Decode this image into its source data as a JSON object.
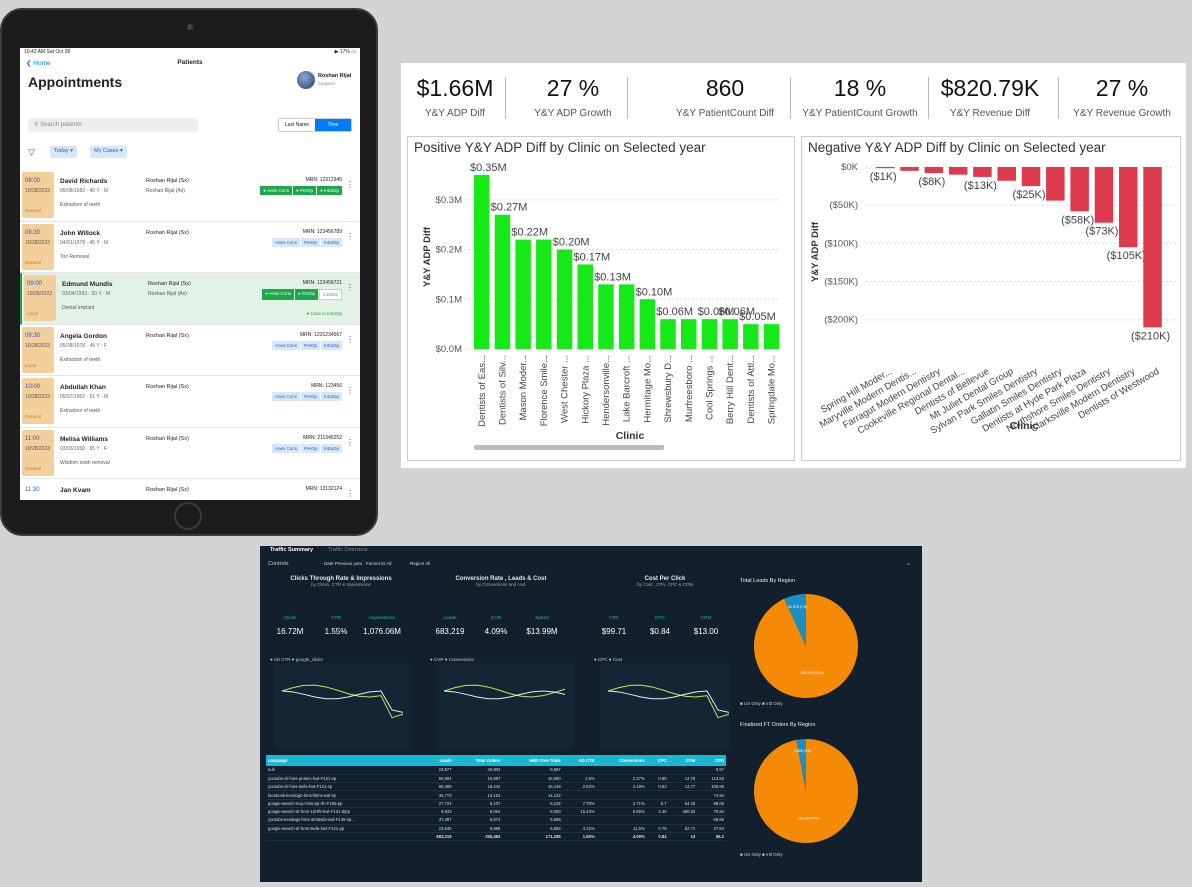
{
  "ipad": {
    "status_time": "10:42 AM  Sat Oct 28",
    "status_battery": "17%",
    "back_label": "Home",
    "nav_title": "Patients",
    "page_title": "Appointments",
    "user_name": "Roshan Rijal",
    "user_role": "Surgeon",
    "search_placeholder": "Search patients",
    "sort_options": [
      "Last Name",
      "Time"
    ],
    "filter_today": "Today ▾",
    "filter_cases": "My Cases ▾",
    "appointments": [
      {
        "time": "08:00",
        "date": "10/28/2023",
        "tag": "General",
        "name": "David Richards",
        "dob": "05/08/1983 · 40 Y · M",
        "proc": "Extraction of teeth",
        "doc": "Roshan Rijal (Sx)",
        "doc2": "Roshan Rijal (Ax)",
        "mrn": "MRN: 12312345",
        "pills": [
          "Anes Cons",
          "PreOp",
          "IntraOp"
        ],
        "state": "green3",
        "status": ""
      },
      {
        "time": "08:30",
        "date": "10/28/2023",
        "tag": "General",
        "name": "John Willock",
        "dob": "04/01/1978 · 45 Y · M",
        "proc": "Tori Removal",
        "doc": "Roshan Rijal (Sx)",
        "doc2": "",
        "mrn": "MRN: 123456789",
        "pills": [
          "Anes Cons",
          "PreOp",
          "IntraOp"
        ],
        "state": "blue",
        "status": ""
      },
      {
        "time": "09:00",
        "date": "10/28/2023",
        "tag": "Local",
        "name": "Edmund Mundis",
        "dob": "03/04/1993 · 30 Y · M",
        "proc": "Dental Implant",
        "doc": "Roshan Rijal (Sx)",
        "doc2": "Roshan Rijal (Ax)",
        "mrn": "MRN: 123456721",
        "pills": [
          "Anes Cons",
          "PreOp",
          "IntraOp"
        ],
        "state": "green2",
        "status": "● Case in IntraOp"
      },
      {
        "time": "09:30",
        "date": "10/28/2023",
        "tag": "Local",
        "name": "Angela Gordon",
        "dob": "05/28/1978 · 45 Y · F",
        "proc": "Extraction of teeth",
        "doc": "Roshan Rijal (Sx)",
        "doc2": "",
        "mrn": "MRN: 1231234567",
        "pills": [
          "Anes Cons",
          "PreOp",
          "IntraOp"
        ],
        "state": "blue",
        "status": ""
      },
      {
        "time": "10:00",
        "date": "10/28/2023",
        "tag": "General",
        "name": "Abdullah Khan",
        "dob": "05/07/1962 · 61 Y · M",
        "proc": "Extraction of teeth",
        "doc": "Roshan Rijal (Sx)",
        "doc2": "",
        "mrn": "MRN: 123456",
        "pills": [
          "Anes Cons",
          "PreOp",
          "IntraOp"
        ],
        "state": "blue",
        "status": ""
      },
      {
        "time": "11:00",
        "date": "10/28/2023",
        "tag": "General",
        "name": "Melisa Williams",
        "dob": "03/03/1958 · 65 Y · F",
        "proc": "Wisdom tooth removal",
        "doc": "Roshan Rijal (Sx)",
        "doc2": "",
        "mrn": "MRN: 211345252",
        "pills": [
          "Anes Cons",
          "PreOp",
          "IntraOp"
        ],
        "state": "blue",
        "status": ""
      },
      {
        "time": "11:30",
        "date": "",
        "tag": "",
        "name": "Jan Kvam",
        "dob": "",
        "proc": "",
        "doc": "Roshan Rijal (Sx)",
        "doc2": "",
        "mrn": "MRN: 12132124",
        "pills": [],
        "state": "none",
        "status": ""
      }
    ]
  },
  "pbi": {
    "kpis": [
      {
        "value": "$1.66M",
        "label": "Y&Y ADP Diff"
      },
      {
        "value": "27 %",
        "label": "Y&Y ADP Growth"
      },
      {
        "value": "860",
        "label": "Y&Y PatientCount Diff"
      },
      {
        "value": "18 %",
        "label": "Y&Y PatientCount Growth"
      },
      {
        "value": "$820.79K",
        "label": "Y&Y Revenue Diff"
      },
      {
        "value": "27 %",
        "label": "Y&Y Revenue Growth"
      }
    ],
    "colors": {
      "positive": "#17e817",
      "negative": "#dd3a4d"
    }
  },
  "chart_data": [
    {
      "type": "bar",
      "title": "Positive Y&Y ADP Diff by Clinic on Selected year",
      "xlabel": "Clinic",
      "ylabel": "Y&Y ADP Diff",
      "ylim": [
        0,
        0.37
      ],
      "yticks": [
        "$0.0M",
        "$0.1M",
        "$0.2M",
        "$0.3M"
      ],
      "categories": [
        "Dentists of Eas...",
        "Dentists of Silv...",
        "Mason Moder...",
        "Florence Smile...",
        "West Chester ...",
        "Hickory Plaza ...",
        "Hendersonville...",
        "Lake Barcroft ...",
        "Hermitage Mo...",
        "Shrewsbury D...",
        "Murfreesboro ...",
        "Cool Springs ...",
        "Berry Hill Dent...",
        "Dentists of Attl...",
        "Springdale Mo..."
      ],
      "values": [
        0.35,
        0.27,
        0.22,
        0.22,
        0.2,
        0.17,
        0.13,
        0.13,
        0.1,
        0.06,
        0.06,
        0.06,
        0.06,
        0.05,
        0.05
      ],
      "data_labels": [
        "$0.35M",
        "$0.27M",
        "$0.22M",
        "",
        "$0.20M",
        "$0.17M",
        "$0.13M",
        "",
        "$0.10M",
        "$0.06M",
        "",
        "$0.06M",
        "$0.06M",
        "$0.05M",
        ""
      ]
    },
    {
      "type": "bar",
      "title": "Negative Y&Y ADP Diff by Clinic on Selected year",
      "xlabel": "Clinic",
      "ylabel": "Y&Y ADP Diff",
      "ylim": [
        -220,
        0
      ],
      "yticks": [
        "$0K",
        "($50K)",
        "($100K)",
        "($150K)",
        "($200K)"
      ],
      "categories": [
        "Spring Hill Moder...",
        "Maryville Modern Dentis...",
        "Farragut Modern Dentistry",
        "Cookeville Regional Dental...",
        "Dentists of Bellevue",
        "Mt Juliet Dental Group",
        "Sylvan Park Smiles Dentistry",
        "Gallatin Smiles Dentistry",
        "Dentists at Hyde Park Plaza",
        "Northshore Smiles Dentistry",
        "Clarksville Modern Dentistry",
        "Dentists of Westwood"
      ],
      "values": [
        -1,
        -5,
        -8,
        -10,
        -13,
        -18,
        -25,
        -44,
        -58,
        -73,
        -105,
        -210
      ],
      "data_labels": [
        "($1K)",
        "",
        "($8K)",
        "",
        "($13K)",
        "",
        "($25K)",
        "",
        "($58K)",
        "($73K)",
        "($105K)",
        "($210K)"
      ]
    },
    {
      "type": "line",
      "title": "Clicks Through Rate & Impressions",
      "series": [
        {
          "name": "AD CTR"
        },
        {
          "name": "google_clicks"
        }
      ]
    },
    {
      "type": "line",
      "title": "Conversion Rate , Leads & Cost",
      "series": [
        {
          "name": "CVR"
        },
        {
          "name": "Conversions"
        }
      ]
    },
    {
      "type": "line",
      "title": "Cost Per Click",
      "series": [
        {
          "name": "CPC"
        },
        {
          "name": "Cost"
        }
      ]
    },
    {
      "type": "pie",
      "title": "Total Leads By Region",
      "categories": [
        "US Only",
        "Intl Only"
      ],
      "values": [
        93.1,
        6.9
      ],
      "data_labels": [
        "635,190 (93%)",
        "41,076 (7%)"
      ]
    },
    {
      "type": "pie",
      "title": "Finalized FT Orders By Region",
      "categories": [
        "US Only",
        "Intl Only"
      ],
      "values": [
        97,
        3
      ],
      "data_labels": [
        "204,38 (97%)",
        "4,888 (3%)"
      ]
    }
  ],
  "traffic": {
    "tabs": [
      "Traffic Summary",
      "Traffic Overview"
    ],
    "controls": "Controls",
    "filters": [
      "Date Previous year",
      "Funnel ID All",
      "Region All"
    ],
    "sections": [
      {
        "title": "Clicks Through Rate & Impressions",
        "sub": "by Clicks, CTR & Impressions",
        "kpis": [
          {
            "l": "Clicks",
            "v": "16.72M"
          },
          {
            "l": "CTR",
            "v": "1.55%"
          },
          {
            "l": "Impressions",
            "v": "1,076.06M"
          }
        ],
        "legend": "● AD CTR  ● google_clicks"
      },
      {
        "title": "Conversion Rate , Leads & Cost",
        "sub": "by Conversions and cost",
        "kpis": [
          {
            "l": "Leads",
            "v": "683,219"
          },
          {
            "l": "CVR",
            "v": "4.09%"
          },
          {
            "l": "Spend",
            "v": "$13.99M"
          }
        ],
        "legend": "● CVR  ● Conversions"
      },
      {
        "title": "Cost Per Click",
        "sub": "by Cost , CPA, CPC & CPM",
        "kpis": [
          {
            "l": "CPA",
            "v": "$99.71"
          },
          {
            "l": "CPC",
            "v": "$0.84"
          },
          {
            "l": "CPM",
            "v": "$13.00"
          }
        ],
        "legend": "● CPC  ● Cost"
      }
    ],
    "pie_legend": "■ US Only   ■ Intl Only",
    "table_headers": [
      "campaign",
      "Leads",
      "Total Orders",
      "HMS Free Trials",
      "AD CTR",
      "Conversions",
      "CPC",
      "CPM",
      "CPO"
    ],
    "table_rows": [
      [
        "null",
        "23,577",
        "40,903",
        "8,867",
        "",
        "",
        "",
        "",
        "0.57"
      ],
      [
        "youtube-dr-hms-protein-hwt-F121-sp",
        "59,894",
        "16,887",
        "16,690",
        "1.5%",
        "2.37%",
        "0.85",
        "12.78",
        "113.53"
      ],
      [
        "youtube-dr-hms-5wfa-hwt-F121-sp",
        "69,389",
        "18,434",
        "16,419",
        "2.03%",
        "2.18%",
        "0.63",
        "12.77",
        "108.66"
      ],
      [
        "facebook-kendogo-hms-fBrnr-waf-sp",
        "45,773",
        "14,153",
        "14,142",
        "",
        "",
        "",
        "",
        "74.94"
      ],
      [
        "google-search-mqc-hms-pp-rfn-F185-pp",
        "27,724",
        "8,107",
        "8,102",
        "7.79%",
        "2.71%",
        "0.7",
        "54.33",
        "88.06"
      ],
      [
        "google-search-dr-hms-10Hf5-hwt-F121-dtpp",
        "9,933",
        "8,064",
        "8,060",
        "15.43%",
        "5.86%",
        "3.45",
        "460.22",
        "70.84"
      ],
      [
        "youtube-kendags-hms-amt5wfa-waf-F145-sp...",
        "47,497",
        "5,974",
        "5,968",
        "",
        "",
        "",
        "",
        "69.55"
      ],
      [
        "google-search-dr-hms-5wfa-hwt-F121-pp",
        "23,545",
        "5,888",
        "5,884",
        "4.12%",
        "11.5%",
        "0.79",
        "52.71",
        "27.64"
      ]
    ],
    "table_total": [
      "",
      "683,219",
      "255,484",
      "171,285",
      "1.55%",
      "4.09%",
      "0.84",
      "13",
      "55.2"
    ]
  }
}
